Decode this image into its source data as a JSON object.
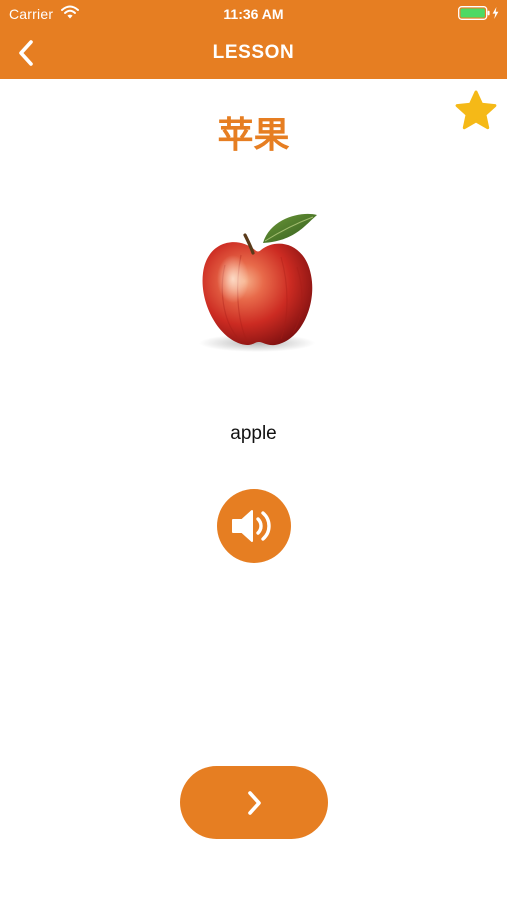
{
  "status_bar": {
    "carrier": "Carrier",
    "time": "11:36 AM",
    "icons": [
      "wifi-icon",
      "battery-icon",
      "charging-bolt-icon"
    ]
  },
  "nav": {
    "title": "LESSON",
    "back_icon": "chevron-left-icon"
  },
  "lesson": {
    "word": "苹果",
    "translation": "apple",
    "image": "red-apple",
    "favorite_icon": "star-icon",
    "sound_icon": "speaker-icon",
    "next_icon": "chevron-right-icon"
  },
  "colors": {
    "accent": "#e67e22",
    "star": "#f5b917",
    "battery": "#4cd964",
    "background": "#ffffff"
  }
}
